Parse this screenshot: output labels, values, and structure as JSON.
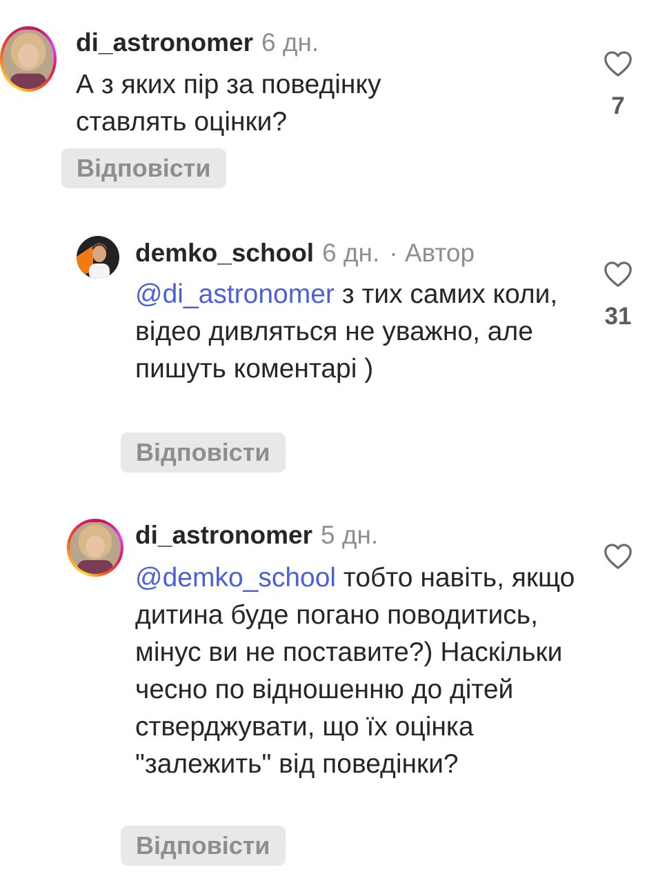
{
  "comments": [
    {
      "username": "di_astronomer",
      "time": "6 дн.",
      "author_tag": "",
      "mention": "",
      "text": "А з яких пір за поведінку ставлять оцінки?",
      "reply_label": "Відповісти",
      "likes": "7",
      "avatar_icon": "user-photo-avatar-female",
      "story_ring": true
    },
    {
      "username": "demko_school",
      "time": "6 дн.",
      "author_tag": "· Автор",
      "mention": "@di_astronomer",
      "text": " з тих самих коли, відео дивляться не уважно, але пишуть коментарі )",
      "reply_label": "Відповісти",
      "likes": "31",
      "avatar_icon": "user-photo-avatar-male",
      "story_ring": false
    },
    {
      "username": "di_astronomer",
      "time": "5 дн.",
      "author_tag": "",
      "mention": "@demko_school",
      "text": " тобто навіть, якщо дитина буде погано поводитись, мінус ви не поставите?) Наскільки чесно по відношенню до дітей стверджувати, що їх оцінка \"залежить\" від поведінки?",
      "reply_label": "Відповісти",
      "likes": "",
      "avatar_icon": "user-photo-avatar-female",
      "story_ring": true
    }
  ],
  "colors": {
    "mention": "#4a5fd8",
    "meta": "#8e8e8e",
    "text": "#262626",
    "reply_bg": "#e8e8e8"
  }
}
